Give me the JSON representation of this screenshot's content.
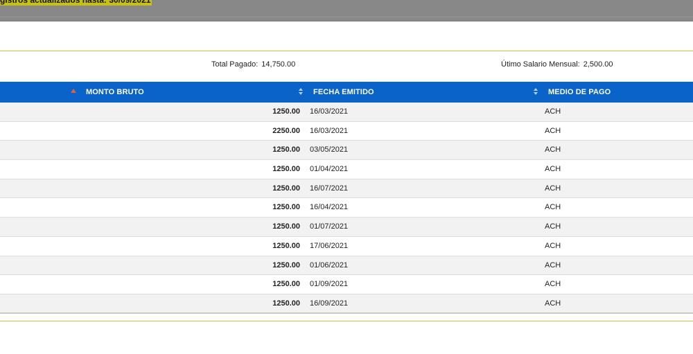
{
  "notice": {
    "text": "gistros actualizados hasta: 30/09/2021"
  },
  "summary": {
    "total_label": "Total Pagado:",
    "total_value": "14,750.00",
    "salary_label": "Útimo Salario Mensual:",
    "salary_value": "2,500.00"
  },
  "table": {
    "columns": [
      "MONTO BRUTO",
      "FECHA EMITIDO",
      "MEDIO DE PAGO"
    ],
    "header_color": "#0a63c9",
    "sort_active_color": "#e1613a",
    "rows": [
      {
        "monto": "1250.00",
        "fecha": "16/03/2021",
        "medio": "ACH"
      },
      {
        "monto": "2250.00",
        "fecha": "16/03/2021",
        "medio": "ACH"
      },
      {
        "monto": "1250.00",
        "fecha": "03/05/2021",
        "medio": "ACH"
      },
      {
        "monto": "1250.00",
        "fecha": "01/04/2021",
        "medio": "ACH"
      },
      {
        "monto": "1250.00",
        "fecha": "16/07/2021",
        "medio": "ACH"
      },
      {
        "monto": "1250.00",
        "fecha": "16/04/2021",
        "medio": "ACH"
      },
      {
        "monto": "1250.00",
        "fecha": "01/07/2021",
        "medio": "ACH"
      },
      {
        "monto": "1250.00",
        "fecha": "17/06/2021",
        "medio": "ACH"
      },
      {
        "monto": "1250.00",
        "fecha": "01/06/2021",
        "medio": "ACH"
      },
      {
        "monto": "1250.00",
        "fecha": "01/09/2021",
        "medio": "ACH"
      },
      {
        "monto": "1250.00",
        "fecha": "16/09/2021",
        "medio": "ACH"
      }
    ]
  },
  "icons": {
    "sort_active": "sort-ascending-icon",
    "sort_inactive": "sort-both-icon"
  }
}
